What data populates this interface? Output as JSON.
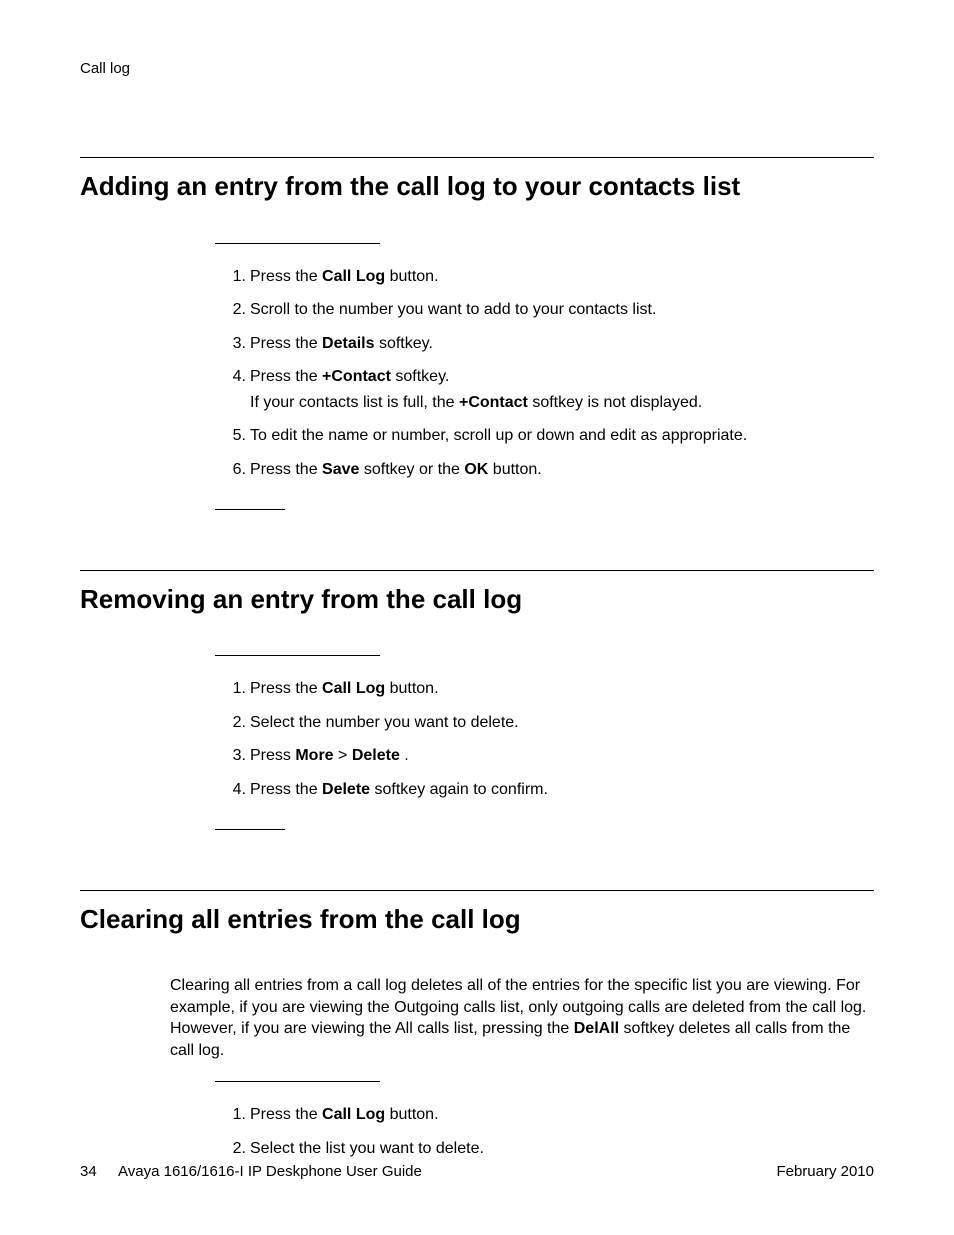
{
  "header": {
    "running": "Call log"
  },
  "sections": [
    {
      "title": "Adding an entry from the call log to your contacts list",
      "intro": null,
      "steps": [
        {
          "html": "Press the <b>Call Log</b> button."
        },
        {
          "html": "Scroll to the number you want to add to your contacts list."
        },
        {
          "html": "Press the <b>Details</b> softkey."
        },
        {
          "html": "Press the <b>+Contact</b> softkey.",
          "sub_html": "If your contacts list is full, the <b>+Contact</b> softkey is not displayed."
        },
        {
          "html": "To edit the name or number, scroll up or down and edit as appropriate."
        },
        {
          "html": "Press the <b>Save</b> softkey or the <b>OK</b> button."
        }
      ]
    },
    {
      "title": "Removing an entry from the call log",
      "intro": null,
      "steps": [
        {
          "html": "Press the <b>Call Log</b> button."
        },
        {
          "html": "Select the number you want to delete."
        },
        {
          "html": "Press <b>More</b> > <b>Delete</b> ."
        },
        {
          "html": "Press the <b>Delete</b> softkey again to confirm."
        }
      ]
    },
    {
      "title": "Clearing all entries from the call log",
      "intro": "Clearing all entries from a call log deletes all of the entries for the specific list you are viewing. For example, if you are viewing the Outgoing calls list, only outgoing calls are deleted from the call log. However, if you are viewing the All calls list, pressing the <b>DelAll</b> softkey deletes all calls from the call log.",
      "steps": [
        {
          "html": "Press the <b>Call Log</b> button."
        },
        {
          "html": "Select the list you want to delete."
        }
      ],
      "no_end_rule": true
    }
  ],
  "footer": {
    "page_number": "34",
    "doc_title": "Avaya 1616/1616-I IP Deskphone User Guide",
    "date": "February 2010"
  }
}
